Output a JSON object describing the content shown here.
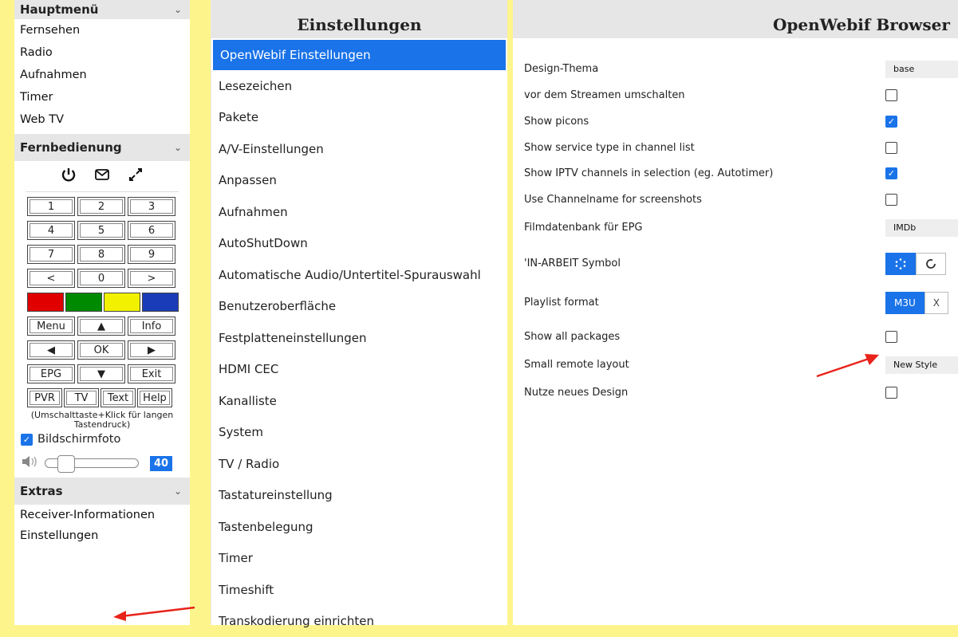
{
  "sidebar": {
    "main_menu_title": "Hauptmenü",
    "main_menu": [
      "Fernsehen",
      "Radio",
      "Aufnahmen",
      "Timer",
      "Web TV"
    ],
    "remote_title": "Fernbedienung",
    "remote_icons": [
      "power-icon",
      "mail-icon",
      "fullscreen-icon"
    ],
    "keys": [
      "1",
      "2",
      "3",
      "4",
      "5",
      "6",
      "7",
      "8",
      "9",
      "<",
      "0",
      ">"
    ],
    "color_keys": [
      "#e00000",
      "#008a00",
      "#f2f200",
      "#1a3cb8"
    ],
    "nav_keys": [
      "Menu",
      "▲",
      "Info",
      "◀",
      "OK",
      "▶",
      "EPG",
      "▼",
      "Exit"
    ],
    "bottom_keys": [
      "PVR",
      "TV",
      "Text",
      "Help"
    ],
    "hint": "(Umschalttaste+Klick für langen Tastendruck)",
    "screenshot_label": "Bildschirmfoto",
    "screenshot_checked": true,
    "volume": 40,
    "volume_fraction": 0.16,
    "extras_title": "Extras",
    "extras": [
      "Receiver-Informationen",
      "Einstellungen"
    ]
  },
  "middle": {
    "title": "Einstellungen",
    "items": [
      "OpenWebif Einstellungen",
      "Lesezeichen",
      "Pakete",
      "A/V-Einstellungen",
      "Anpassen",
      "Aufnahmen",
      "AutoShutDown",
      "Automatische Audio/Untertitel-Spurauswahl",
      "Benutzeroberfläche",
      "Festplatteneinstellungen",
      "HDMI CEC",
      "Kanalliste",
      "System",
      "TV / Radio",
      "Tastatureinstellung",
      "Tastenbelegung",
      "Timer",
      "Timeshift",
      "Transkodierung einrichten"
    ],
    "active_index": 0
  },
  "right": {
    "title": "OpenWebif Browser",
    "settings": [
      {
        "label": "Design-Thema",
        "type": "select",
        "value": "base"
      },
      {
        "label": "vor dem Streamen umschalten",
        "type": "checkbox",
        "checked": false
      },
      {
        "label": "Show picons",
        "type": "checkbox",
        "checked": true
      },
      {
        "label": "Show service type in channel list",
        "type": "checkbox",
        "checked": false
      },
      {
        "label": "Show IPTV channels in selection (eg. Autotimer)",
        "type": "checkbox",
        "checked": true
      },
      {
        "label": "Use Channelname for screenshots",
        "type": "checkbox",
        "checked": false
      },
      {
        "label": "Filmdatenbank für EPG",
        "type": "select",
        "value": "IMDb"
      },
      {
        "label": "'IN-ARBEIT Symbol",
        "type": "buttons",
        "options": [
          "spinner-icon",
          "circle-icon"
        ],
        "selected": 0
      },
      {
        "label": "Playlist format",
        "type": "buttons",
        "options": [
          "M3U",
          "X"
        ],
        "selected": 0
      },
      {
        "label": "Show all packages",
        "type": "checkbox",
        "checked": false
      },
      {
        "label": "Small remote layout",
        "type": "select",
        "value": "New Style"
      },
      {
        "label": "Nutze neues Design",
        "type": "checkbox",
        "checked": false
      }
    ]
  },
  "colors": {
    "background": "#fdf58c",
    "accent": "#1a73e8",
    "arrow": "#e8231a"
  }
}
